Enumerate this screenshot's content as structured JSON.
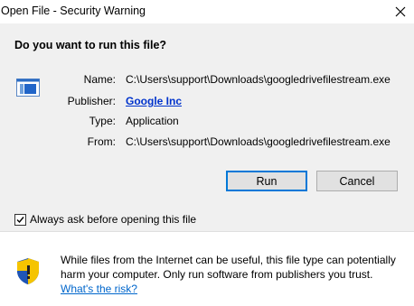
{
  "window": {
    "title": "Open File - Security Warning"
  },
  "dialog": {
    "question": "Do you want to run this file?",
    "fields": {
      "name_label": "Name:",
      "name_value": "C:\\Users\\support\\Downloads\\googledrivefilestream.exe",
      "publisher_label": "Publisher:",
      "publisher_value": "Google Inc",
      "type_label": "Type:",
      "type_value": "Application",
      "from_label": "From:",
      "from_value": "C:\\Users\\support\\Downloads\\googledrivefilestream.exe"
    },
    "buttons": {
      "run": "Run",
      "cancel": "Cancel"
    },
    "checkbox": {
      "label": "Always ask before opening this file",
      "checked": true
    },
    "warning": {
      "text": "While files from the Internet can be useful, this file type can potentially harm your computer. Only run software from publishers you trust.",
      "link": "What's the risk?"
    }
  },
  "icons": {
    "close": "close-icon",
    "app": "application-icon",
    "shield": "security-shield-icon",
    "check": "checkmark-icon"
  },
  "colors": {
    "link": "#0033cc",
    "default_button_border": "#0078d7",
    "panel_bg": "#f0f0f0",
    "shield_yellow": "#f5c400",
    "shield_blue": "#1f55b5"
  }
}
